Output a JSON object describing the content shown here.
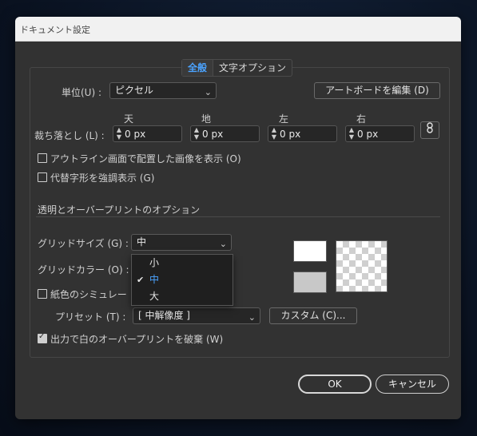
{
  "window": {
    "title": "ドキュメント設定"
  },
  "tabs": [
    {
      "label": "全般",
      "active": true
    },
    {
      "label": "文字オプション",
      "active": false
    }
  ],
  "units": {
    "label": "単位(U) :",
    "value": "ピクセル"
  },
  "artboard_button": "アートボードを編集 (D)",
  "bleed": {
    "label": "裁ち落とし (L) :",
    "columns": [
      {
        "heading": "天",
        "value": "0 px"
      },
      {
        "heading": "地",
        "value": "0 px"
      },
      {
        "heading": "左",
        "value": "0 px"
      },
      {
        "heading": "右",
        "value": "0 px"
      }
    ]
  },
  "link_icon": "chain-link-icon",
  "options": {
    "outline_images": {
      "label": "アウトライン画面で配置した画像を表示 (O)",
      "checked": false
    },
    "highlight_glyphs": {
      "label": "代替字形を強調表示 (G)",
      "checked": false
    }
  },
  "transparency": {
    "section_title": "透明とオーバープリントのオプション",
    "grid_size": {
      "label": "グリッドサイズ (G) :",
      "value": "中"
    },
    "grid_color": {
      "label": "グリッドカラー (O) :"
    },
    "paper_sim": {
      "label": "紙色のシミュレー",
      "checked": false
    },
    "preset": {
      "label": "プリセット (T) :",
      "value": "[ 中解像度 ]"
    },
    "custom_button": "カスタム (C)...",
    "discard_white": {
      "label": "出力で白のオーバープリントを破棄 (W)",
      "checked": true
    }
  },
  "grid_size_dropdown": {
    "options": [
      {
        "label": "小",
        "selected": false
      },
      {
        "label": "中",
        "selected": true
      },
      {
        "label": "大",
        "selected": false
      }
    ]
  },
  "footer": {
    "ok": "OK",
    "cancel": "キャンセル"
  },
  "colors": {
    "accent": "#4ba3ff",
    "dialog_bg": "#323232",
    "swatch_white": "#ffffff",
    "swatch_gray": "#c8c8c8"
  }
}
